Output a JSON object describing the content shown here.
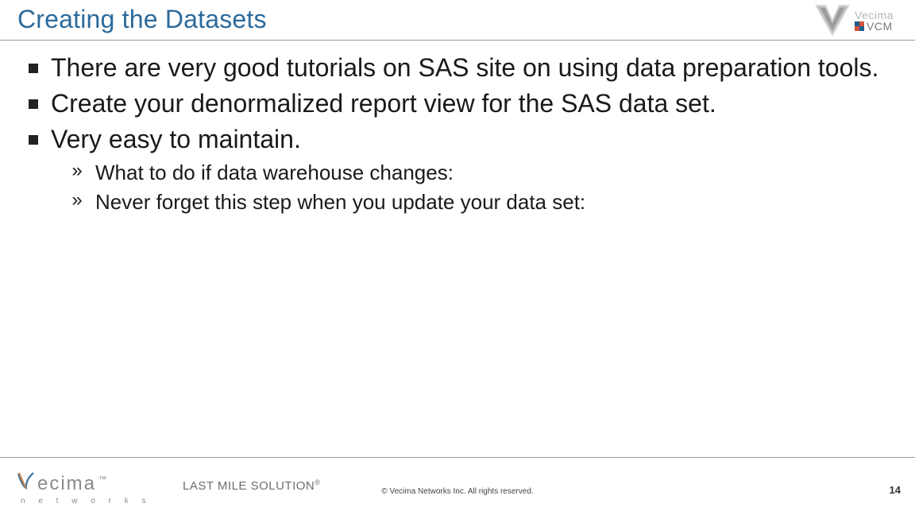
{
  "header": {
    "title": "Creating the Datasets",
    "logo": {
      "line1": "Vecima",
      "line2": "VCM"
    }
  },
  "bullets": [
    {
      "text": "There are very good tutorials on SAS site on using data preparation tools."
    },
    {
      "text": "Create your denormalized report view for the SAS data set."
    },
    {
      "text": "Very easy to maintain."
    }
  ],
  "subbullets": [
    {
      "text": "What to do if data warehouse changes:"
    },
    {
      "text": "Never forget this step when you update your data set:"
    }
  ],
  "footer": {
    "brand_letters": "ecima",
    "brand_sub": "n e t w o r k s",
    "tagline": "LAST MILE SOLUTION",
    "copyright": "© Vecima Networks Inc. All rights reserved.",
    "page_number": "14"
  }
}
